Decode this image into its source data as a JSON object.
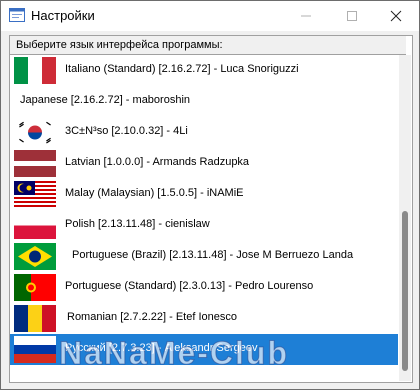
{
  "window": {
    "title": "Настройки"
  },
  "list": {
    "header": "Выберите язык интерфейса программы:",
    "items": [
      {
        "label": "Italiano (Standard) [2.16.2.72] - Luca Snoriguzzi",
        "flag": "italy-flag"
      },
      {
        "label": "Japanese [2.16.2.72] - maboroshin",
        "flag": "none"
      },
      {
        "label": "3C±N³so [2.10.0.32] - 4Li",
        "flag": "south-korea-flag"
      },
      {
        "label": "Latvian [1.0.0.0] - Armands Radzupka",
        "flag": "latvia-flag"
      },
      {
        "label": "Malay (Malaysian) [1.5.0.5] - iNAMiE",
        "flag": "malaysia-flag"
      },
      {
        "label": "Polish [2.13.11.48] - cienislaw",
        "flag": "poland-flag"
      },
      {
        "label": "Portuguese (Brazil) [2.13.11.48] - Jose M Berruezo Landa",
        "flag": "brazil-flag"
      },
      {
        "label": "Portuguese (Standard) [2.3.0.13] - Pedro Lourenso",
        "flag": "portugal-flag"
      },
      {
        "label": "Romanian [2.7.2.22] - Etef Ionesco",
        "flag": "romania-flag"
      },
      {
        "label": "Русский [2.7.3.23] - Aleksandr Sergeev",
        "flag": "russia-flag",
        "selected": true
      }
    ]
  },
  "watermark": "NaNaMe-Club",
  "colors": {
    "selection": "#1e7fd6",
    "title_bar": "#ffffff"
  }
}
